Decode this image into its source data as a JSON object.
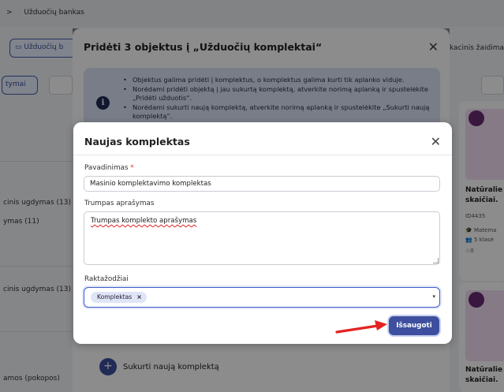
{
  "background": {
    "breadcrumb": {
      "sep": ">",
      "current": "Užduočių bankas"
    },
    "tabs": {
      "active_label": "Užduočių b",
      "right_label": "kacinis žaidimas"
    },
    "filter_button": "tymai",
    "left_panel": {
      "items": [
        "cinis ugdymas (13)",
        "ymas (11)",
        "cinis ugdymas (13)",
        "amos (pokopos)"
      ]
    },
    "cards": [
      {
        "title_lines": [
          "Natūralie",
          "skaičiai."
        ],
        "id": "ID4435",
        "subject": "Matema",
        "grade": "5 klasė",
        "rating": "0"
      },
      {
        "title_lines": [
          "Natūralie",
          "skaičiai."
        ]
      }
    ]
  },
  "outer_modal": {
    "title": "Pridėti 3 objektus į „Užduočių komplektai“",
    "close_icon": "close-icon",
    "info_icon": "info-icon",
    "info_items": [
      "Objektus galima pridėti į komplektus, o komplektus galima kurti tik aplanko viduje.",
      "Norėdami pridėti objektą į jau sukurtą komplektą, atverkite norimą aplanką ir spustelėkite „Pridėti užduotis“.",
      "Norėdami sukurti naują komplektą, atverkite norimą aplanką ir spustelėkite „Sukurti naują komplektą“."
    ],
    "create_button_icon": "plus-icon",
    "create_button_label": "Sukurti naują komplektą"
  },
  "inner_modal": {
    "title": "Naujas komplektas",
    "close_icon": "close-icon",
    "name_label": "Pavadinimas",
    "required_mark": "*",
    "name_value": "Masinio komplektavimo komplektas",
    "description_label": "Trumpas aprašymas",
    "description_value": "Trumpas komplekto aprašymas",
    "keywords_label": "Raktažodžiai",
    "keywords": [
      {
        "label": "Komplektas",
        "remove": "×"
      }
    ],
    "dropdown_caret": "▾",
    "save_label": "Išsaugoti"
  },
  "colors": {
    "primary": "#3d4f9e",
    "info_bg": "#dde3f7",
    "annotation_arrow": "#e32222",
    "required": "#d0342c"
  }
}
